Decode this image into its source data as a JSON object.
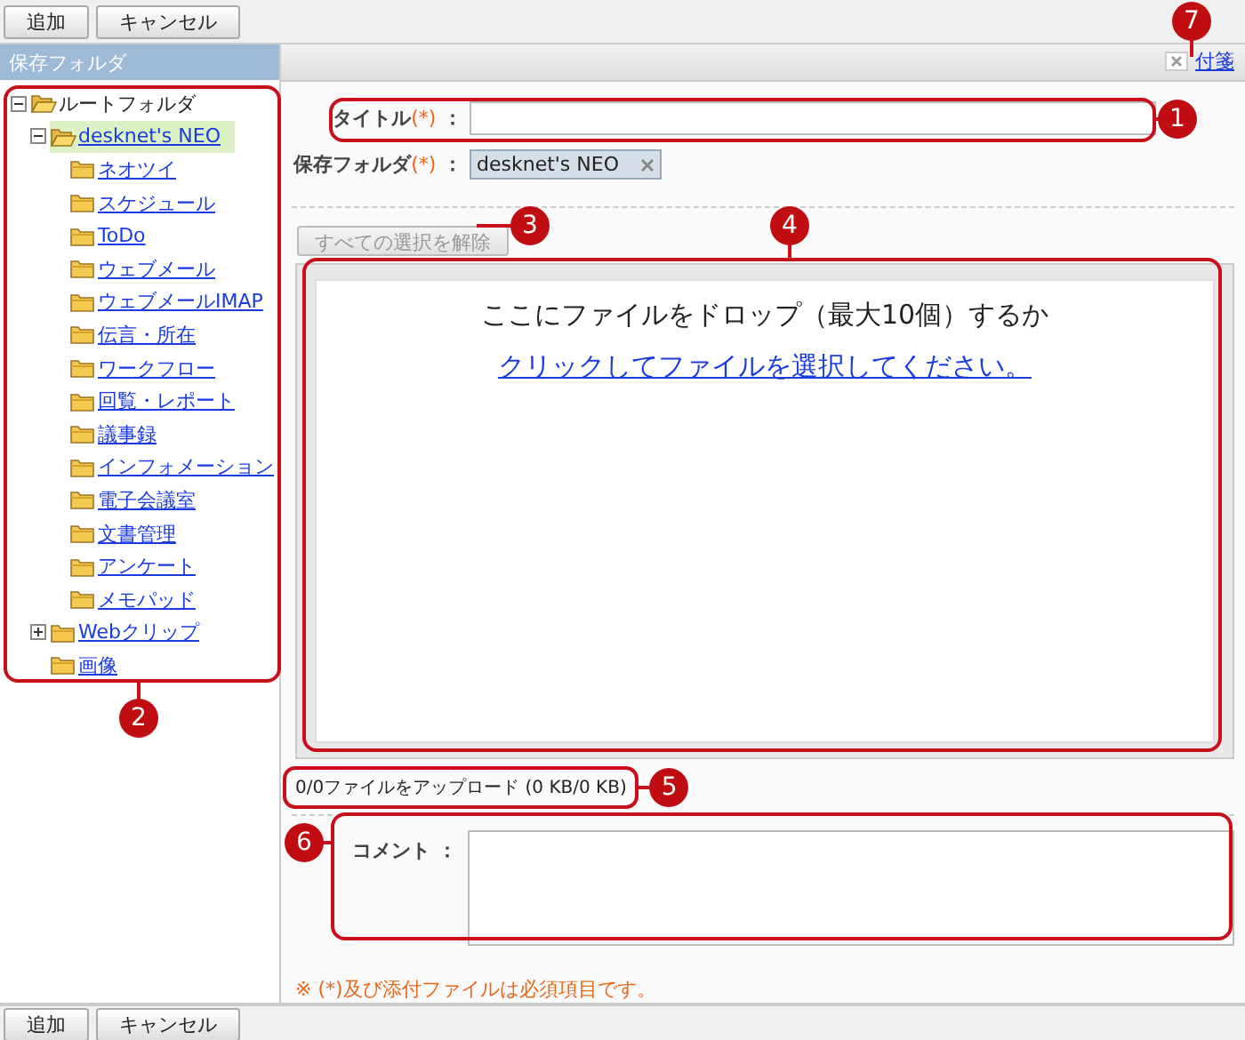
{
  "toolbar_top": {
    "buttons": [
      "追加",
      "キャンセル"
    ]
  },
  "sidebar": {
    "title": "保存フォルダ",
    "tree": [
      {
        "label": "ルートフォルダ",
        "link": false,
        "expandable": true,
        "expanded": true,
        "selected": false,
        "children": [
          {
            "label": "desknet's NEO",
            "link": true,
            "expandable": true,
            "expanded": true,
            "selected": true,
            "children": [
              {
                "label": "ネオツイ",
                "link": true,
                "expandable": false,
                "expanded": false,
                "selected": false
              },
              {
                "label": "スケジュール",
                "link": true,
                "expandable": false,
                "expanded": false,
                "selected": false
              },
              {
                "label": "ToDo",
                "link": true,
                "expandable": false,
                "expanded": false,
                "selected": false
              },
              {
                "label": "ウェブメール",
                "link": true,
                "expandable": false,
                "expanded": false,
                "selected": false
              },
              {
                "label": "ウェブメールIMAP",
                "link": true,
                "expandable": false,
                "expanded": false,
                "selected": false
              },
              {
                "label": "伝言・所在",
                "link": true,
                "expandable": false,
                "expanded": false,
                "selected": false
              },
              {
                "label": "ワークフロー",
                "link": true,
                "expandable": false,
                "expanded": false,
                "selected": false
              },
              {
                "label": "回覧・レポート",
                "link": true,
                "expandable": false,
                "expanded": false,
                "selected": false
              },
              {
                "label": "議事録",
                "link": true,
                "expandable": false,
                "expanded": false,
                "selected": false
              },
              {
                "label": "インフォメーション",
                "link": true,
                "expandable": false,
                "expanded": false,
                "selected": false
              },
              {
                "label": "電子会議室",
                "link": true,
                "expandable": false,
                "expanded": false,
                "selected": false
              },
              {
                "label": "文書管理",
                "link": true,
                "expandable": false,
                "expanded": false,
                "selected": false
              },
              {
                "label": "アンケート",
                "link": true,
                "expandable": false,
                "expanded": false,
                "selected": false
              },
              {
                "label": "メモパッド",
                "link": true,
                "expandable": false,
                "expanded": false,
                "selected": false
              }
            ]
          },
          {
            "label": "Webクリップ",
            "link": true,
            "expandable": true,
            "expanded": false,
            "selected": false
          },
          {
            "label": "画像",
            "link": true,
            "expandable": false,
            "expanded": false,
            "selected": false
          }
        ]
      }
    ]
  },
  "panel_header": {
    "sticky_note_link": "付箋"
  },
  "form": {
    "title_field": {
      "label": "タイトル",
      "required_mark": "(*)",
      "separator": "："
    },
    "folder_field": {
      "label": "保存フォルダ",
      "required_mark": "(*)",
      "separator": "：",
      "tag": "desknet's NEO"
    },
    "clear_button": {
      "label": "すべての選択を解除",
      "disabled": true
    },
    "dropzone": {
      "prompt": "ここにファイルをドロップ（最大10個）するか",
      "link": "クリックしてファイルを選択してください。"
    },
    "upload_status": "0/0ファイルをアップロード (0 KB/0 KB)",
    "comment_field": {
      "label": "コメント",
      "separator": "："
    },
    "note": {
      "mark": "※",
      "text": "(*)及び添付ファイルは必須項目です。"
    }
  },
  "toolbar_bottom": {
    "buttons": [
      "追加",
      "キャンセル"
    ]
  },
  "annotations": [
    {
      "number": "1"
    },
    {
      "number": "2"
    },
    {
      "number": "3"
    },
    {
      "number": "4"
    },
    {
      "number": "5"
    },
    {
      "number": "6"
    },
    {
      "number": "7"
    }
  ]
}
